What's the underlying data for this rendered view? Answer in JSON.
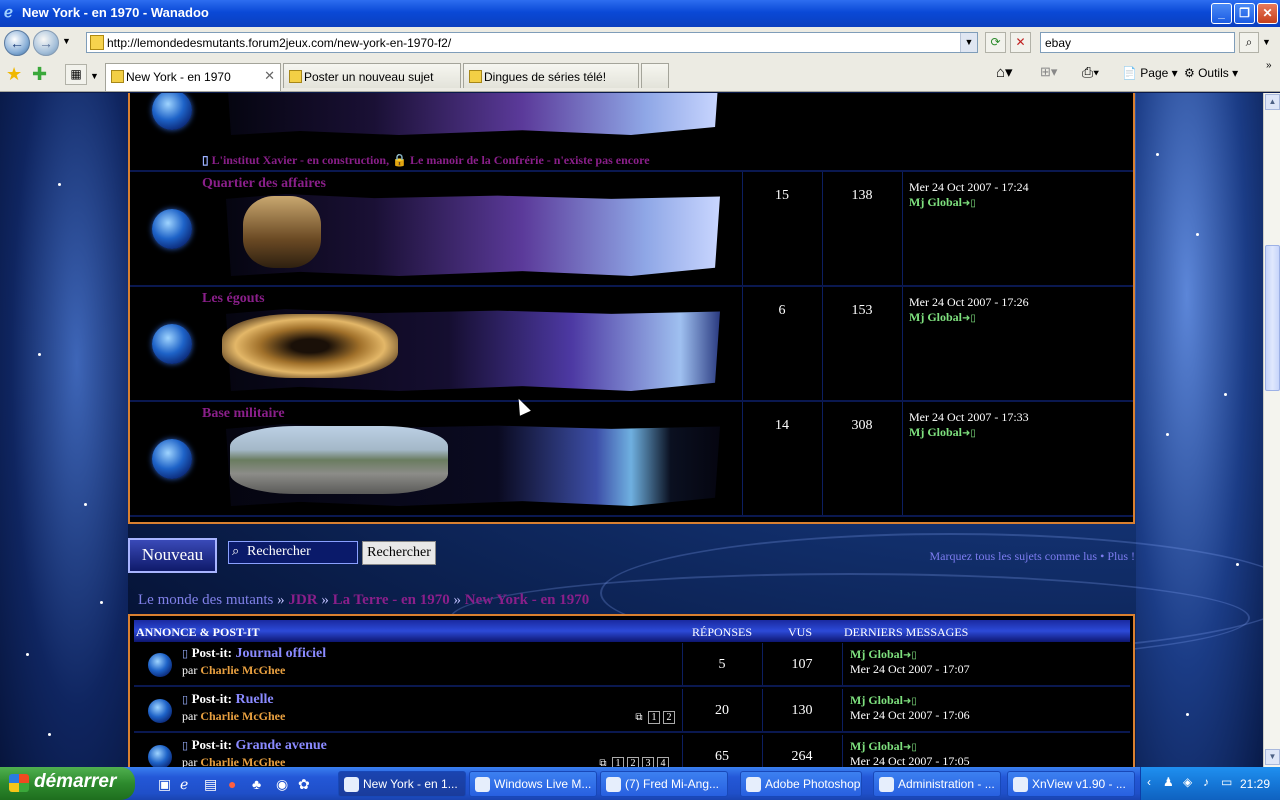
{
  "window": {
    "title": "New York - en 1970 - Wanadoo"
  },
  "nav": {
    "url": "http://lemondedesmutants.forum2jeux.com/new-york-en-1970-f2/",
    "search_value": "ebay"
  },
  "tabs": [
    {
      "label": "New York - en 1970",
      "active": true
    },
    {
      "label": "Poster un nouveau sujet",
      "active": false
    },
    {
      "label": "Dingues de séries télé!",
      "active": false
    }
  ],
  "toolbar": {
    "page_label": "Page",
    "tools_label": "Outils"
  },
  "forums": [
    {
      "name": "",
      "topics": "",
      "posts": "",
      "last_date": "",
      "last_user": "",
      "sublinks": [
        "L'institut Xavier - en construction",
        "Le manoir de la Confrérie - n'existe pas encore"
      ]
    },
    {
      "name": "Quartier des affaires",
      "topics": "15",
      "posts": "138",
      "last_date": "Mer 24 Oct 2007 - 17:24",
      "last_user": "Mj Global"
    },
    {
      "name": "Les égouts",
      "topics": "6",
      "posts": "153",
      "last_date": "Mer 24 Oct 2007 - 17:26",
      "last_user": "Mj Global"
    },
    {
      "name": "Base militaire",
      "topics": "14",
      "posts": "308",
      "last_date": "Mer 24 Oct 2007 - 17:33",
      "last_user": "Mj Global"
    }
  ],
  "actions": {
    "new_label": "Nouveau",
    "search_placeholder": "Rechercher",
    "search_button": "Rechercher",
    "mark_read": "Marquez tous les sujets comme lus",
    "more": "Plus !",
    "bullet": "•"
  },
  "breadcrumb": [
    "Le monde des mutants",
    "JDR",
    "La Terre - en 1970",
    "New York - en 1970"
  ],
  "breadcrumb_sep": "»",
  "announce": {
    "headers": {
      "title": "ANNONCE & POST-IT",
      "replies": "RÉPONSES",
      "views": "VUS",
      "last": "DERNIERS MESSAGES"
    },
    "postit_label": "Post-it:",
    "by_label": "par",
    "rows": [
      {
        "title": "Journal officiel",
        "author": "Charlie McGhee",
        "replies": "5",
        "views": "107",
        "last_user": "Mj Global",
        "last_date": "Mer 24 Oct 2007 - 17:07",
        "pages": []
      },
      {
        "title": "Ruelle",
        "author": "Charlie McGhee",
        "replies": "20",
        "views": "130",
        "last_user": "Mj Global",
        "last_date": "Mer 24 Oct 2007 - 17:06",
        "pages": [
          "1",
          "2"
        ]
      },
      {
        "title": "Grande avenue",
        "author": "Charlie McGhee",
        "replies": "65",
        "views": "264",
        "last_user": "Mj Global",
        "last_date": "Mer 24 Oct 2007 - 17:05",
        "pages": [
          "1",
          "2",
          "3",
          "4"
        ]
      }
    ]
  },
  "taskbar": {
    "start": "démarrer",
    "tasks": [
      "New York - en 1...",
      "Windows Live M...",
      "(7) Fred Mi-Ang...",
      "Adobe Photoshop",
      "Administration - ...",
      "XnView v1.90 - ..."
    ],
    "clock": "21:29"
  }
}
